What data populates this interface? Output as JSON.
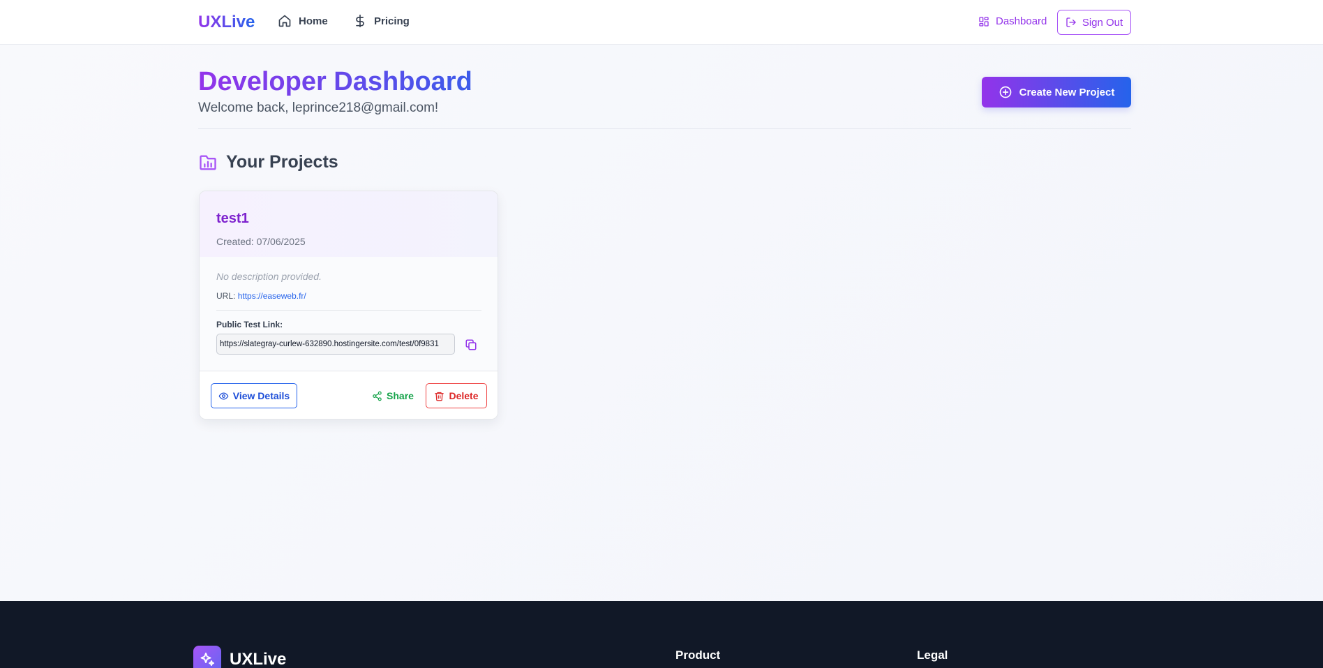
{
  "header": {
    "brand": "UXLive",
    "nav": [
      {
        "label": "Home",
        "icon": "home-icon"
      },
      {
        "label": "Pricing",
        "icon": "dollar-icon"
      }
    ],
    "dashboard_label": "Dashboard",
    "signout_label": "Sign Out"
  },
  "page": {
    "title": "Developer Dashboard",
    "welcome": "Welcome back, leprince218@gmail.com!",
    "create_label": "Create New Project",
    "section_title": "Your Projects"
  },
  "project": {
    "name": "test1",
    "created": "Created: 07/06/2025",
    "description": "No description provided.",
    "url_label": "URL:",
    "url": "https://easeweb.fr/",
    "public_link_label": "Public Test Link:",
    "public_link": "https://slategray-curlew-632890.hostingersite.com/test/0f9831",
    "view_label": "View Details",
    "share_label": "Share",
    "delete_label": "Delete"
  },
  "footer": {
    "brand": "UXLive",
    "columns": [
      "Product",
      "Legal"
    ]
  },
  "colors": {
    "accent_purple": "#9333ea",
    "accent_blue": "#2563eb",
    "share_green": "#16a34a",
    "delete_red": "#dc2626",
    "footer_bg": "#111827"
  }
}
